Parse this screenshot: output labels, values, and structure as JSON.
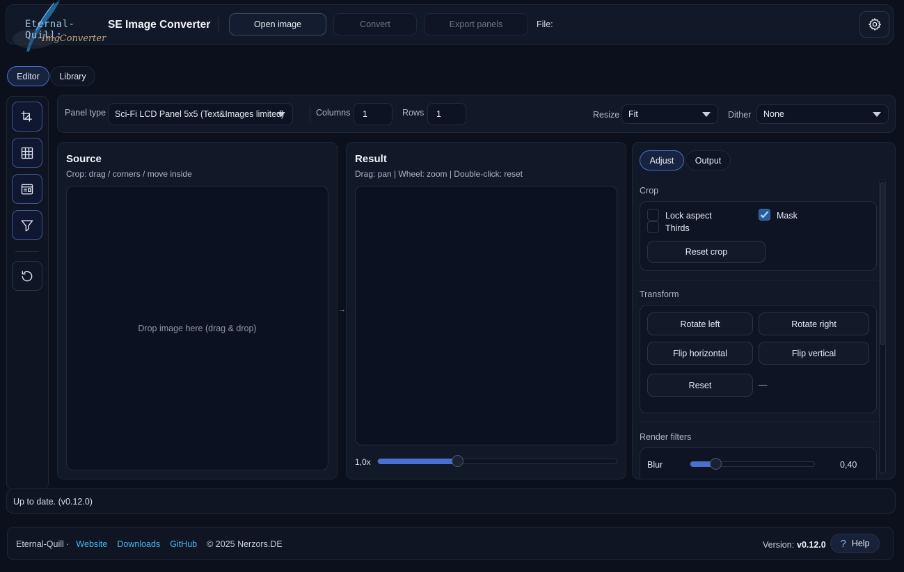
{
  "app": {
    "logo_text": "Eternal-Quill:",
    "logo_sub": "ImgConverter",
    "title": "SE Image Converter",
    "file_label": "File:"
  },
  "toolbar": {
    "open_label": "Open image",
    "convert_label": "Convert",
    "export_label": "Export panels"
  },
  "tabs": {
    "editor": "Editor",
    "library": "Library"
  },
  "controls": {
    "panel_type_label": "Panel type",
    "panel_type_value": "Sci-Fi LCD Panel 5x5 (Text&Images limited)",
    "columns_label": "Columns",
    "columns_value": "1",
    "rows_label": "Rows",
    "rows_value": "1",
    "resize_label": "Resize",
    "resize_value": "Fit",
    "dither_label": "Dither",
    "dither_value": "None"
  },
  "source": {
    "title": "Source",
    "hint": "Crop: drag / corners / move inside",
    "drop_text": "Drop image here (drag & drop)"
  },
  "arrow": "→",
  "result": {
    "title": "Result",
    "hint": "Drag: pan | Wheel: zoom | Double-click: reset",
    "zoom_value": "1,0x",
    "zoom_fraction": 0.33
  },
  "right_panel": {
    "tab_adjust": "Adjust",
    "tab_output": "Output",
    "crop": {
      "heading": "Crop",
      "lock_aspect": "Lock aspect",
      "lock_aspect_checked": false,
      "mask": "Mask",
      "mask_checked": true,
      "thirds": "Thirds",
      "thirds_checked": false,
      "reset_crop": "Reset crop"
    },
    "transform": {
      "heading": "Transform",
      "rotate_left": "Rotate left",
      "rotate_right": "Rotate right",
      "flip_h": "Flip horizontal",
      "flip_v": "Flip vertical",
      "reset": "Reset",
      "reset_value": "—"
    },
    "render_filters": {
      "heading": "Render filters",
      "blur_label": "Blur",
      "blur_value": "0,40",
      "blur_fraction": 0.2
    }
  },
  "status": {
    "text": "Up to date. (v0.12.0)"
  },
  "footer": {
    "brand": "Eternal-Quill ·",
    "website": "Website",
    "downloads": "Downloads",
    "github": "GitHub",
    "copyright": "© 2025 Nerzors.DE",
    "version_label": "Version:",
    "version_value": "v0.12.0",
    "help": "Help"
  },
  "colors": {
    "background": "#0b101c",
    "accent": "#4a6fd0",
    "link": "#4fb6f0",
    "mask_check": "#4aa3e8"
  }
}
